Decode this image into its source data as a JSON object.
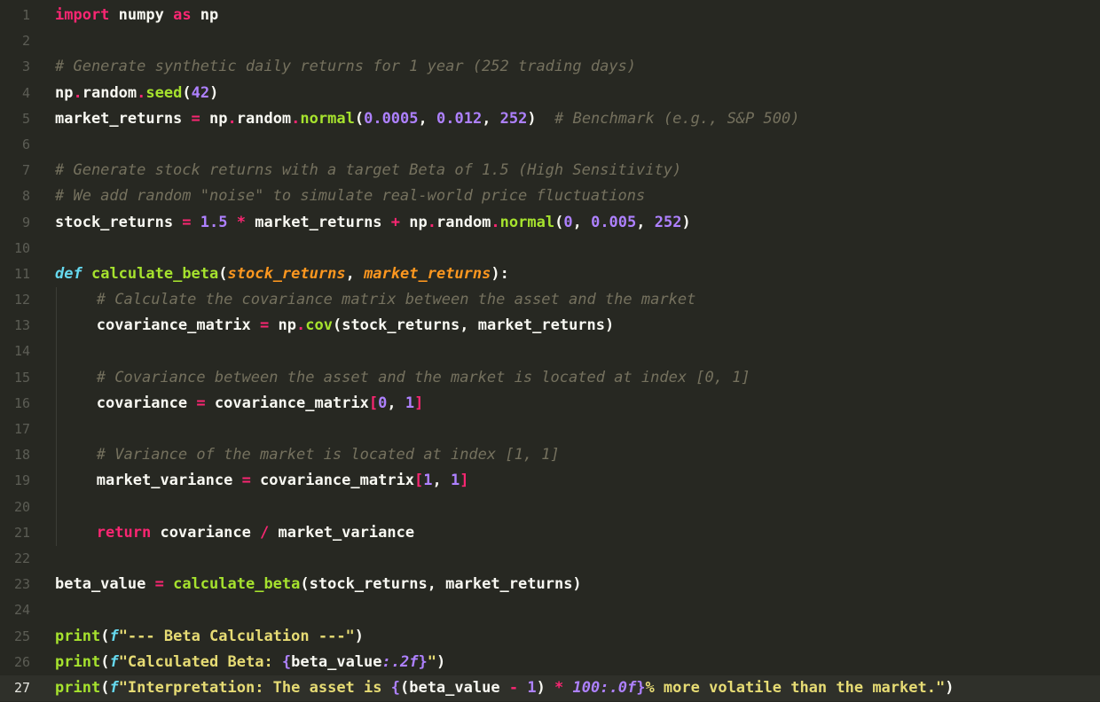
{
  "editor": {
    "active_line": 27,
    "lines": [
      {
        "n": "1",
        "indent": 0,
        "tokens": [
          [
            "kw",
            "import"
          ],
          [
            "tx",
            " numpy "
          ],
          [
            "kw",
            "as"
          ],
          [
            "tx",
            " np"
          ]
        ]
      },
      {
        "n": "2",
        "indent": 0,
        "tokens": []
      },
      {
        "n": "3",
        "indent": 0,
        "tokens": [
          [
            "cm",
            "# Generate synthetic daily returns for 1 year (252 trading days)"
          ]
        ]
      },
      {
        "n": "4",
        "indent": 0,
        "tokens": [
          [
            "tx",
            "np"
          ],
          [
            "op",
            "."
          ],
          [
            "tx",
            "random"
          ],
          [
            "op",
            "."
          ],
          [
            "fn",
            "seed"
          ],
          [
            "tx",
            "("
          ],
          [
            "num",
            "42"
          ],
          [
            "tx",
            ")"
          ]
        ]
      },
      {
        "n": "5",
        "indent": 0,
        "tokens": [
          [
            "tx",
            "market_returns "
          ],
          [
            "op",
            "="
          ],
          [
            "tx",
            " np"
          ],
          [
            "op",
            "."
          ],
          [
            "tx",
            "random"
          ],
          [
            "op",
            "."
          ],
          [
            "fn",
            "normal"
          ],
          [
            "tx",
            "("
          ],
          [
            "num",
            "0.0005"
          ],
          [
            "tx",
            ", "
          ],
          [
            "num",
            "0.012"
          ],
          [
            "tx",
            ", "
          ],
          [
            "num",
            "252"
          ],
          [
            "tx",
            ")  "
          ],
          [
            "cm",
            "# Benchmark (e.g., S&P 500)"
          ]
        ]
      },
      {
        "n": "6",
        "indent": 0,
        "tokens": []
      },
      {
        "n": "7",
        "indent": 0,
        "tokens": [
          [
            "cm",
            "# Generate stock returns with a target Beta of 1.5 (High Sensitivity)"
          ]
        ]
      },
      {
        "n": "8",
        "indent": 0,
        "tokens": [
          [
            "cm",
            "# We add random \"noise\" to simulate real-world price fluctuations"
          ]
        ]
      },
      {
        "n": "9",
        "indent": 0,
        "tokens": [
          [
            "tx",
            "stock_returns "
          ],
          [
            "op",
            "="
          ],
          [
            "tx",
            " "
          ],
          [
            "num",
            "1.5"
          ],
          [
            "tx",
            " "
          ],
          [
            "op",
            "*"
          ],
          [
            "tx",
            " market_returns "
          ],
          [
            "op",
            "+"
          ],
          [
            "tx",
            " np"
          ],
          [
            "op",
            "."
          ],
          [
            "tx",
            "random"
          ],
          [
            "op",
            "."
          ],
          [
            "fn",
            "normal"
          ],
          [
            "tx",
            "("
          ],
          [
            "num",
            "0"
          ],
          [
            "tx",
            ", "
          ],
          [
            "num",
            "0.005"
          ],
          [
            "tx",
            ", "
          ],
          [
            "num",
            "252"
          ],
          [
            "tx",
            ")"
          ]
        ]
      },
      {
        "n": "10",
        "indent": 0,
        "tokens": []
      },
      {
        "n": "11",
        "indent": 0,
        "tokens": [
          [
            "kwi",
            "def"
          ],
          [
            "tx",
            " "
          ],
          [
            "fn",
            "calculate_beta"
          ],
          [
            "tx",
            "("
          ],
          [
            "param",
            "stock_returns"
          ],
          [
            "tx",
            ", "
          ],
          [
            "param",
            "market_returns"
          ],
          [
            "tx",
            "):"
          ]
        ]
      },
      {
        "n": "12",
        "indent": 1,
        "tokens": [
          [
            "cm",
            "# Calculate the covariance matrix between the asset and the market"
          ]
        ]
      },
      {
        "n": "13",
        "indent": 1,
        "tokens": [
          [
            "tx",
            "covariance_matrix "
          ],
          [
            "op",
            "="
          ],
          [
            "tx",
            " np"
          ],
          [
            "op",
            "."
          ],
          [
            "fn",
            "cov"
          ],
          [
            "tx",
            "(stock_returns, market_returns)"
          ]
        ]
      },
      {
        "n": "14",
        "indent": 1,
        "tokens": []
      },
      {
        "n": "15",
        "indent": 1,
        "tokens": [
          [
            "cm",
            "# Covariance between the asset and the market is located at index [0, 1]"
          ]
        ]
      },
      {
        "n": "16",
        "indent": 1,
        "tokens": [
          [
            "tx",
            "covariance "
          ],
          [
            "op",
            "="
          ],
          [
            "tx",
            " covariance_matrix"
          ],
          [
            "op",
            "["
          ],
          [
            "num",
            "0"
          ],
          [
            "tx",
            ", "
          ],
          [
            "num",
            "1"
          ],
          [
            "op",
            "]"
          ]
        ]
      },
      {
        "n": "17",
        "indent": 1,
        "tokens": []
      },
      {
        "n": "18",
        "indent": 1,
        "tokens": [
          [
            "cm",
            "# Variance of the market is located at index [1, 1]"
          ]
        ]
      },
      {
        "n": "19",
        "indent": 1,
        "tokens": [
          [
            "tx",
            "market_variance "
          ],
          [
            "op",
            "="
          ],
          [
            "tx",
            " covariance_matrix"
          ],
          [
            "op",
            "["
          ],
          [
            "num",
            "1"
          ],
          [
            "tx",
            ", "
          ],
          [
            "num",
            "1"
          ],
          [
            "op",
            "]"
          ]
        ]
      },
      {
        "n": "20",
        "indent": 1,
        "tokens": []
      },
      {
        "n": "21",
        "indent": 1,
        "tokens": [
          [
            "kw",
            "return"
          ],
          [
            "tx",
            " covariance "
          ],
          [
            "op",
            "/"
          ],
          [
            "tx",
            " market_variance"
          ]
        ]
      },
      {
        "n": "22",
        "indent": 0,
        "tokens": []
      },
      {
        "n": "23",
        "indent": 0,
        "tokens": [
          [
            "tx",
            "beta_value "
          ],
          [
            "op",
            "="
          ],
          [
            "tx",
            " "
          ],
          [
            "fn",
            "calculate_beta"
          ],
          [
            "tx",
            "(stock_returns, market_returns)"
          ]
        ]
      },
      {
        "n": "24",
        "indent": 0,
        "tokens": []
      },
      {
        "n": "25",
        "indent": 0,
        "tokens": [
          [
            "fn",
            "print"
          ],
          [
            "tx",
            "("
          ],
          [
            "fpre",
            "f"
          ],
          [
            "str",
            "\"--- Beta Calculation ---\""
          ],
          [
            "tx",
            ")"
          ]
        ]
      },
      {
        "n": "26",
        "indent": 0,
        "tokens": [
          [
            "fn",
            "print"
          ],
          [
            "tx",
            "("
          ],
          [
            "fpre",
            "f"
          ],
          [
            "str",
            "\"Calculated Beta: "
          ],
          [
            "num",
            "{"
          ],
          [
            "tx",
            "beta_value"
          ],
          [
            "fmt",
            ":.2f"
          ],
          [
            "num",
            "}"
          ],
          [
            "str",
            "\""
          ],
          [
            "tx",
            ")"
          ]
        ]
      },
      {
        "n": "27",
        "indent": 0,
        "tokens": [
          [
            "fn",
            "print"
          ],
          [
            "tx",
            "("
          ],
          [
            "fpre",
            "f"
          ],
          [
            "str",
            "\"Interpretation: The asset is "
          ],
          [
            "num",
            "{"
          ],
          [
            "tx",
            "(beta_value "
          ],
          [
            "op",
            "-"
          ],
          [
            "tx",
            " "
          ],
          [
            "num",
            "1"
          ],
          [
            "tx",
            ") "
          ],
          [
            "op",
            "*"
          ],
          [
            "tx",
            " "
          ],
          [
            "fmt",
            "100:.0f"
          ],
          [
            "num",
            "}"
          ],
          [
            "str",
            "% more volatile than the market.\""
          ],
          [
            "tx",
            ")"
          ]
        ]
      }
    ]
  }
}
